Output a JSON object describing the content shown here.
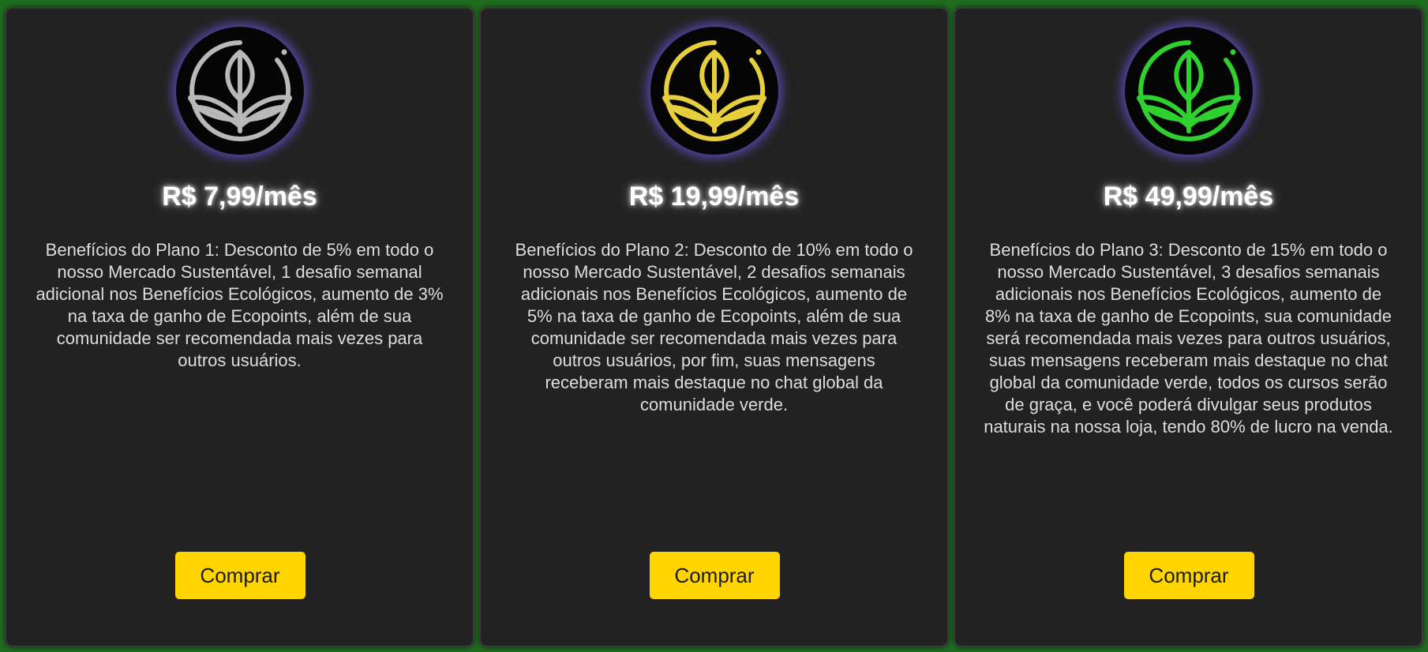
{
  "plans": [
    {
      "price": "R$ 7,99/mês",
      "description": "Benefícios do Plano 1: Desconto de 5% em todo o nosso Mercado Sustentável, 1 desafio semanal adicional nos Benefícios Ecológicos, aumento de 3% na taxa de ganho de Ecopoints, além de sua comunidade ser recomendada mais vezes para outros usuários.",
      "button_label": "Comprar",
      "icon": "leaf-icon",
      "icon_color": "#b9b9b9"
    },
    {
      "price": "R$ 19,99/mês",
      "description": "Benefícios do Plano 2: Desconto de 10% em todo o nosso Mercado Sustentável, 2 desafios semanais adicionais nos Benefícios Ecológicos, aumento de 5% na taxa de ganho de Ecopoints, além de sua comunidade ser recomendada mais vezes para outros usuários, por fim, suas mensagens receberam mais destaque no chat global da comunidade verde.",
      "button_label": "Comprar",
      "icon": "leaf-icon",
      "icon_color": "#e6cf3c"
    },
    {
      "price": "R$ 49,99/mês",
      "description": "Benefícios do Plano 3: Desconto de 15% em todo o nosso Mercado Sustentável, 3 desafios semanais adicionais nos Benefícios Ecológicos, aumento de 8% na taxa de ganho de Ecopoints, sua comunidade será recomendada mais vezes para outros usuários, suas mensagens receberam mais destaque no chat global da comunidade verde, todos os cursos serão de graça, e você poderá divulgar seus produtos naturais na nossa loja, tendo 80% de lucro na venda.",
      "button_label": "Comprar",
      "icon": "leaf-icon",
      "icon_color": "#2fd12f"
    }
  ],
  "colors": {
    "page_background": "#1f6b1f",
    "card_background": "#222222",
    "button_background": "#ffd500",
    "emblem_glow": "#6e5ae6"
  }
}
